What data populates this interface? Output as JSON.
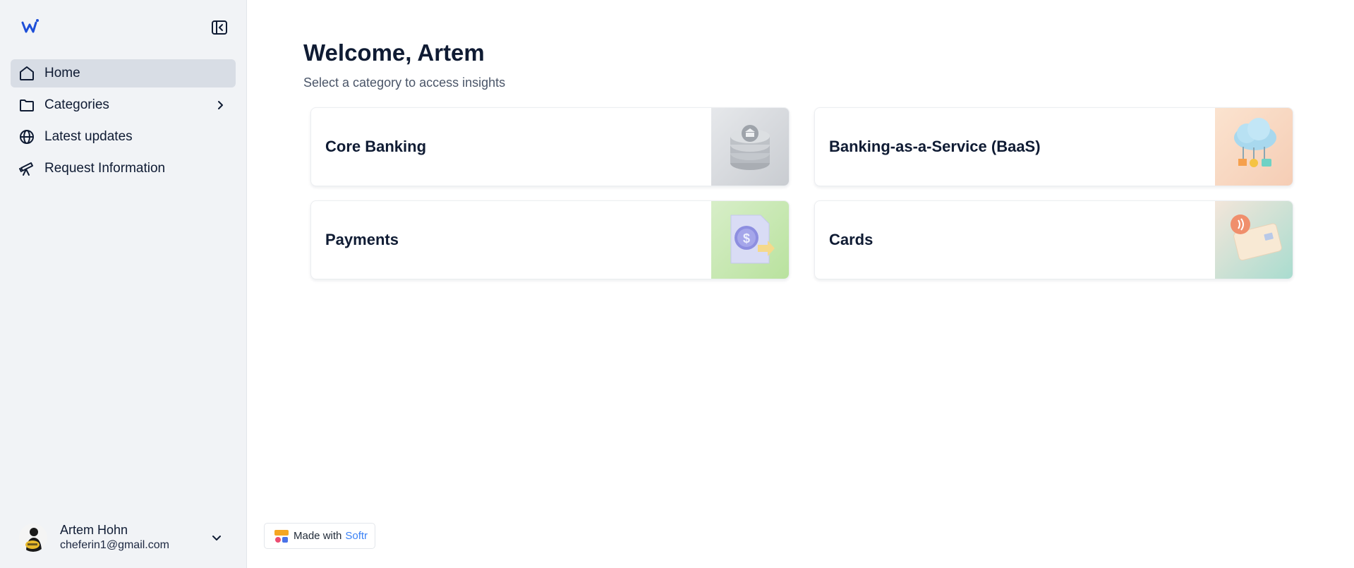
{
  "sidebar": {
    "logo_alt": "w",
    "items": [
      {
        "label": "Home",
        "icon": "home-icon",
        "active": true
      },
      {
        "label": "Categories",
        "icon": "folder-icon",
        "has_submenu": true
      },
      {
        "label": "Latest updates",
        "icon": "globe-icon"
      },
      {
        "label": "Request Information",
        "icon": "telescope-icon"
      }
    ],
    "user": {
      "name": "Artem Hohn",
      "email": "cheferin1@gmail.com"
    }
  },
  "main": {
    "title": "Welcome, Artem",
    "subtitle": "Select a category to access insights",
    "cards": [
      {
        "title": "Core Banking",
        "image": "bank-stack-illustration"
      },
      {
        "title": "Banking-as-a-Service (BaaS)",
        "image": "cloud-services-illustration"
      },
      {
        "title": "Payments",
        "image": "dollar-document-illustration"
      },
      {
        "title": "Cards",
        "image": "contactless-card-illustration"
      }
    ]
  },
  "badge": {
    "prefix": "Made with",
    "brand": "Softr"
  },
  "colors": {
    "sidebar_bg": "#f1f3f6",
    "active_item_bg": "#d8dde5",
    "text_primary": "#0f1b33",
    "brand_blue": "#3b82f6",
    "logo_blue": "#1d4ed8"
  }
}
